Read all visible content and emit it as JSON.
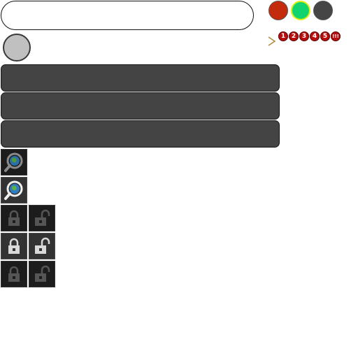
{
  "input": {
    "value": "",
    "placeholder": ""
  },
  "colors": {
    "red": "#c42a0c",
    "green": "#10d470",
    "green_ring": "#e0ef10",
    "dark": "#454545",
    "knob": "#c0c0c0",
    "bar": "#444444",
    "badge": "#b90e0e"
  },
  "badges": [
    "1",
    "2",
    "3",
    "4",
    "5",
    "!!!"
  ],
  "bars": [
    {
      "label": ""
    },
    {
      "label": ""
    },
    {
      "label": ""
    }
  ],
  "icons": {
    "search_tile": "search-globe-icon",
    "lock_closed": "lock-closed-icon",
    "lock_open": "lock-open-icon",
    "chevron": "chevron-right-icon"
  }
}
